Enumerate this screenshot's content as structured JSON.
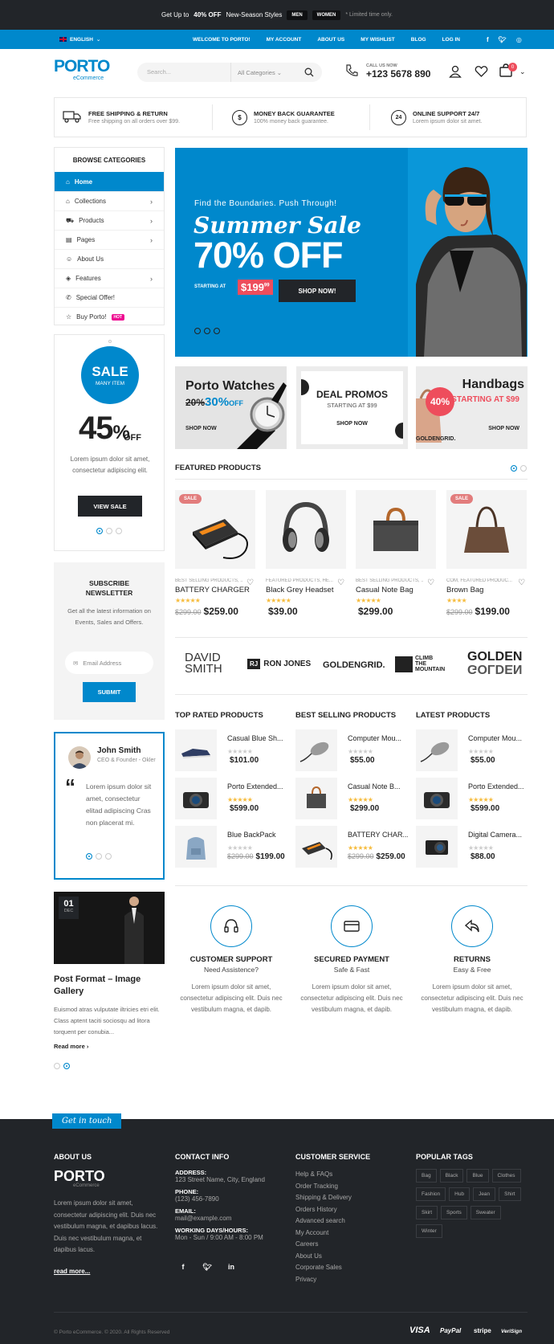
{
  "topbar": {
    "pre": "Get Up to",
    "bold": "40% OFF",
    "post": "New-Season Styles",
    "men": "MEN",
    "women": "WOMEN",
    "limited": "* Limited time only."
  },
  "bluebar": {
    "lang": "ENGLISH",
    "links": [
      "WELCOME TO PORTO!",
      "MY ACCOUNT",
      "ABOUT US",
      "MY WISHLIST",
      "BLOG",
      "LOG IN"
    ]
  },
  "header": {
    "logo": "PORTO",
    "logo_sub": "eCommerce",
    "search_placeholder": "Search...",
    "category": "All Categories",
    "call_label": "CALL US NOW",
    "phone": "+123 5678 890",
    "cart_count": "0"
  },
  "features": [
    {
      "title": "FREE SHIPPING & RETURN",
      "sub": "Free shipping on all orders over $99."
    },
    {
      "title": "MONEY BACK GUARANTEE",
      "sub": "100% money back guarantee."
    },
    {
      "title": "ONLINE SUPPORT 24/7",
      "sub": "Lorem ipsum dolor sit amet."
    }
  ],
  "categories": {
    "title": "BROWSE CATEGORIES",
    "items": [
      "Home",
      "Collections",
      "Products",
      "Pages",
      "About Us",
      "Features",
      "Special Offer!",
      "Buy Porto!"
    ],
    "hot": "HOT"
  },
  "salebox": {
    "sale": "SALE",
    "many": "MANY ITEM",
    "num": "45",
    "pct": "%",
    "off": "OFF",
    "text": "Lorem ipsum dolor sit amet, consectetur adipiscing elit.",
    "button": "VIEW SALE"
  },
  "newsletter": {
    "title": "SUBSCRIBE NEWSLETTER",
    "text": "Get all the latest information on Events, Sales and Offers.",
    "placeholder": "Email Address",
    "button": "SUBMIT"
  },
  "testimonial": {
    "name": "John Smith",
    "role": "CEO & Founder - Okler",
    "text": "Lorem ipsum dolor sit amet, consectetur elitad adipiscing Cras non placerat mi."
  },
  "post": {
    "day": "01",
    "month": "DEC",
    "title": "Post Format – Image Gallery",
    "excerpt": "Euismod atras vulputate iltricies etri elit. Class aptent taciti sociosqu ad litora torquent per conubia...",
    "more": "Read more ›"
  },
  "banner": {
    "kicker": "Find the Boundaries. Push Through!",
    "headline": "Summer Sale",
    "offer": "70% OFF",
    "starting": "STARTING AT",
    "price": "$199",
    "cents": "99",
    "button": "SHOP NOW!"
  },
  "promos": [
    {
      "title": "Porto Watches",
      "old": "20%",
      "new": "30%",
      "off": "OFF",
      "cta": "SHOP NOW"
    },
    {
      "title": "DEAL PROMOS",
      "sub": "STARTING AT $99",
      "cta": "SHOP NOW"
    },
    {
      "title": "Handbags",
      "badge": "40%",
      "sub": "STARTING AT $99",
      "cta": "SHOP NOW",
      "brand": "GOLDENGRID."
    }
  ],
  "featured": {
    "title": "FEATURED PRODUCTS",
    "sale_label": "SALE",
    "products": [
      {
        "cat": "BEST SELLING PRODUCTS, ...",
        "name": "BATTERY CHARGER",
        "old": "$299.00",
        "price": "$259.00",
        "stars": "★★★★★"
      },
      {
        "cat": "FEATURED PRODUCTS, HE...",
        "name": "Black Grey Headset",
        "old": "",
        "price": "$39.00",
        "stars": "★★★★★"
      },
      {
        "cat": "BEST SELLING PRODUCTS, ...",
        "name": "Casual Note Bag",
        "old": "",
        "price": "$299.00",
        "stars": "★★★★★"
      },
      {
        "cat": "COM, FEATURED PRODUC...",
        "name": "Brown Bag",
        "old": "$299.00",
        "price": "$199.00",
        "stars": "★★★★"
      }
    ]
  },
  "brands": [
    "DAVID",
    "SMITH",
    "RON JONES",
    "GOLDENGRID.",
    "CLIMB",
    "THE",
    "MOUNTAIN",
    "GOLDEN"
  ],
  "lists": {
    "titles": [
      "TOP RATED PRODUCTS",
      "BEST SELLING PRODUCTS",
      "LATEST PRODUCTS"
    ],
    "items": [
      [
        {
          "n": "Casual Blue Sh...",
          "o": "",
          "p": "$101.00"
        },
        {
          "n": "Porto Extended...",
          "o": "",
          "p": "$599.00"
        },
        {
          "n": "Blue BackPack",
          "o": "$299.00",
          "p": "$199.00"
        }
      ],
      [
        {
          "n": "Computer Mou...",
          "o": "",
          "p": "$55.00"
        },
        {
          "n": "Casual Note B...",
          "o": "",
          "p": "$299.00"
        },
        {
          "n": "BATTERY CHAR...",
          "o": "$299.00",
          "p": "$259.00"
        }
      ],
      [
        {
          "n": "Computer Mou...",
          "o": "",
          "p": "$55.00"
        },
        {
          "n": "Porto Extended...",
          "o": "",
          "p": "$599.00"
        },
        {
          "n": "Digital Camera...",
          "o": "",
          "p": "$88.00"
        }
      ]
    ]
  },
  "services": [
    {
      "title": "CUSTOMER SUPPORT",
      "sub": "Need Assistence?",
      "desc": "Lorem ipsum dolor sit amet, consectetur adipiscing elit. Duis nec vestibulum magna, et dapib."
    },
    {
      "title": "SECURED PAYMENT",
      "sub": "Safe & Fast",
      "desc": "Lorem ipsum dolor sit amet, consectetur adipiscing elit. Duis nec vestibulum magna, et dapib."
    },
    {
      "title": "RETURNS",
      "sub": "Easy & Free",
      "desc": "Lorem ipsum dolor sit amet, consectetur adipiscing elit. Duis nec vestibulum magna, et dapib."
    }
  ],
  "footer": {
    "tab": "Get in touch",
    "about_title": "ABOUT US",
    "about_text": "Lorem ipsum dolor sit amet, consectetur adipiscing elit. Duis nec vestibulum magna, et dapibus lacus. Duis nec vestibulum magna, et dapibus lacus.",
    "read_more": "read more...",
    "contact_title": "CONTACT INFO",
    "contact": [
      {
        "k": "ADDRESS:",
        "v": "123 Street Name, City, England"
      },
      {
        "k": "PHONE:",
        "v": "(123) 456-7890"
      },
      {
        "k": "EMAIL:",
        "v": "mail@example.com"
      },
      {
        "k": "WORKING DAYS/HOURS:",
        "v": "Mon - Sun / 9:00 AM - 8:00 PM"
      }
    ],
    "service_title": "CUSTOMER SERVICE",
    "service_links": [
      "Help & FAQs",
      "Order Tracking",
      "Shipping & Delivery",
      "Orders History",
      "Advanced search",
      "My Account",
      "Careers",
      "About Us",
      "Corporate Sales",
      "Privacy"
    ],
    "tags_title": "POPULAR TAGS",
    "tags": [
      "Bag",
      "Black",
      "Blue",
      "Clothes",
      "Fashion",
      "Hub",
      "Jean",
      "Shirt",
      "Skirt",
      "Sports",
      "Sweater",
      "Winter"
    ],
    "copyright": "© Porto eCommerce. © 2020. All Rights Reserved",
    "payments": [
      "VISA",
      "PayPal",
      "stripe",
      "VeriSign"
    ]
  }
}
